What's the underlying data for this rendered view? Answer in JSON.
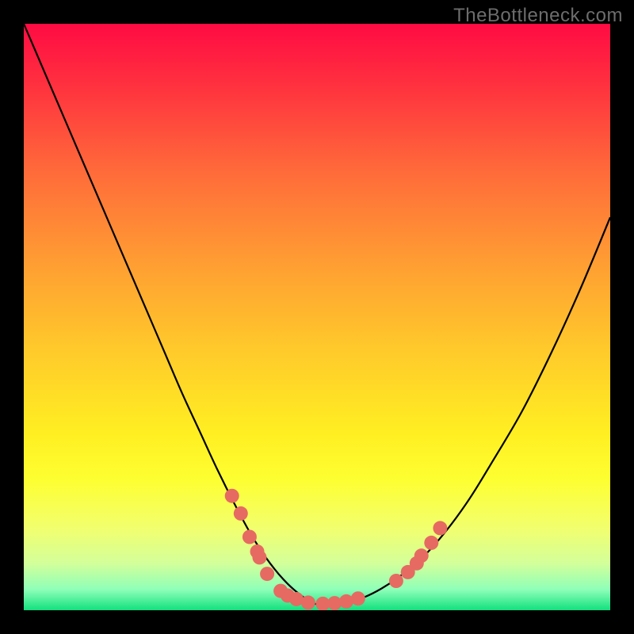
{
  "watermark": "TheBottleneck.com",
  "chart_data": {
    "type": "line",
    "title": "",
    "xlabel": "",
    "ylabel": "",
    "xlim": [
      0,
      100
    ],
    "ylim": [
      0,
      100
    ],
    "x_min": 0.45,
    "series": [
      {
        "name": "curve",
        "color": "#000000",
        "x": [
          0,
          3,
          6,
          9,
          12,
          15,
          18,
          21,
          24,
          27,
          30,
          33,
          36,
          39,
          42,
          45,
          48,
          50,
          52,
          55,
          58,
          61,
          64,
          68,
          72,
          76,
          80,
          85,
          90,
          95,
          100
        ],
        "y": [
          100,
          93,
          86,
          79,
          72,
          65,
          58,
          51,
          44,
          37,
          30.5,
          24,
          18,
          12.5,
          8,
          4.5,
          2,
          1,
          1,
          1.3,
          2.2,
          3.7,
          5.7,
          9,
          13.5,
          19,
          25.5,
          34,
          44,
          55,
          67
        ]
      }
    ],
    "dots": {
      "name": "markers",
      "color": "#e66a62",
      "radius": 9,
      "points": [
        {
          "x": 35.5,
          "y": 19.5
        },
        {
          "x": 37.0,
          "y": 16.5
        },
        {
          "x": 38.5,
          "y": 12.5
        },
        {
          "x": 39.8,
          "y": 10.0
        },
        {
          "x": 40.2,
          "y": 9.0
        },
        {
          "x": 41.5,
          "y": 6.2
        },
        {
          "x": 43.8,
          "y": 3.3
        },
        {
          "x": 45.0,
          "y": 2.5
        },
        {
          "x": 46.5,
          "y": 1.9
        },
        {
          "x": 48.5,
          "y": 1.3
        },
        {
          "x": 51.0,
          "y": 1.1
        },
        {
          "x": 53.0,
          "y": 1.2
        },
        {
          "x": 55.0,
          "y": 1.5
        },
        {
          "x": 57.0,
          "y": 2.0
        },
        {
          "x": 63.5,
          "y": 5.0
        },
        {
          "x": 65.5,
          "y": 6.5
        },
        {
          "x": 67.0,
          "y": 8.0
        },
        {
          "x": 67.8,
          "y": 9.3
        },
        {
          "x": 69.5,
          "y": 11.5
        },
        {
          "x": 71.0,
          "y": 14.0
        }
      ]
    },
    "gradient_stops": [
      {
        "offset": 0.0,
        "color": "#ff0b43"
      },
      {
        "offset": 0.1,
        "color": "#ff2f3f"
      },
      {
        "offset": 0.25,
        "color": "#ff6a3a"
      },
      {
        "offset": 0.4,
        "color": "#ff9b33"
      },
      {
        "offset": 0.55,
        "color": "#ffc82b"
      },
      {
        "offset": 0.7,
        "color": "#ffef22"
      },
      {
        "offset": 0.78,
        "color": "#fdff32"
      },
      {
        "offset": 0.86,
        "color": "#f2ff6e"
      },
      {
        "offset": 0.92,
        "color": "#d3ff9a"
      },
      {
        "offset": 0.965,
        "color": "#8effb8"
      },
      {
        "offset": 1.0,
        "color": "#12e07e"
      }
    ]
  }
}
